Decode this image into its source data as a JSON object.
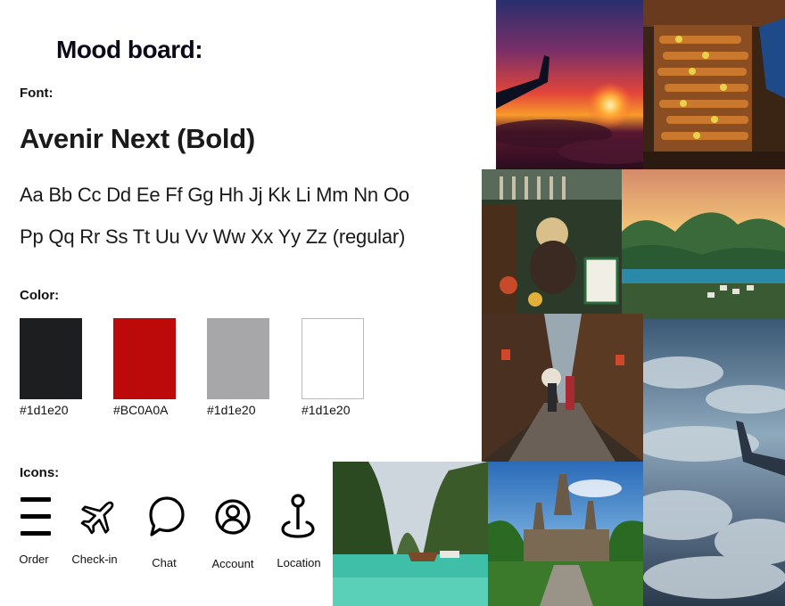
{
  "title": "Mood board:",
  "font": {
    "label": "Font:",
    "name": "Avenir Next (Bold)",
    "alphabet_line1": "Aa Bb Cc Dd Ee Ff Gg Hh Jj Kk  Li  Mm Nn Oo",
    "alphabet_line2": "Pp Qq Rr Ss Tt Uu Vv Ww Xx Yy Zz (regular)"
  },
  "color": {
    "label": "Color:",
    "swatches": [
      {
        "hex_label": "#1d1e20",
        "fill": "#1d1e20"
      },
      {
        "hex_label": "#BC0A0A",
        "fill": "#bc0a0a"
      },
      {
        "hex_label": "#1d1e20",
        "fill": "#a7a7a9"
      },
      {
        "hex_label": "#1d1e20",
        "fill": "#ffffff"
      }
    ]
  },
  "icons": {
    "label": "Icons:",
    "items": [
      {
        "icon": "menu-icon",
        "label": "Order"
      },
      {
        "icon": "airplane-icon",
        "label": "Check-in"
      },
      {
        "icon": "chat-bubble-icon",
        "label": "Chat"
      },
      {
        "icon": "account-icon",
        "label": "Account"
      },
      {
        "icon": "location-pin-icon",
        "label": "Location"
      }
    ]
  },
  "photos": [
    "sunset-wing-photo",
    "street-skewers-photo",
    "floating-market-photo",
    "tropical-bay-photo",
    "old-alley-photo",
    "clouds-wing-photo",
    "limestone-lagoon-photo",
    "temple-photo"
  ]
}
